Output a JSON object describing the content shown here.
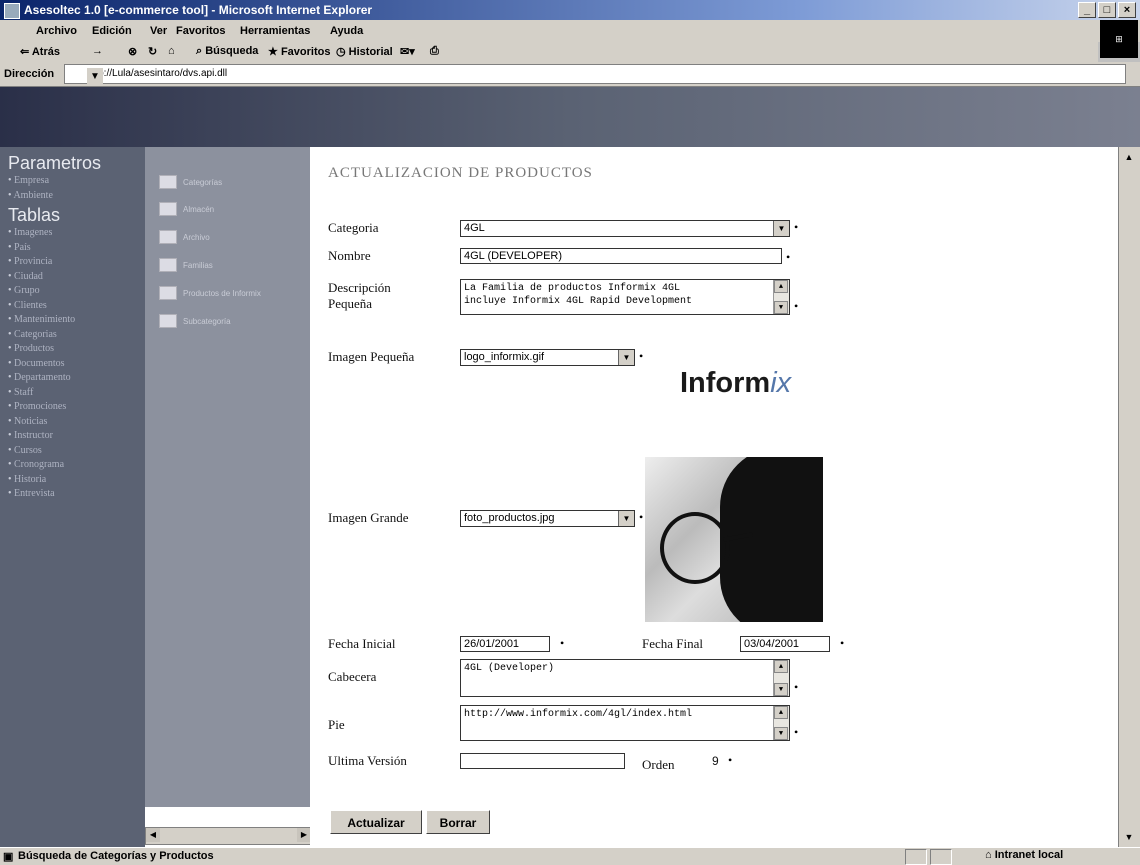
{
  "window": {
    "title": "Asesoltec 1.0 [e-commerce tool] - Microsoft Internet Explorer",
    "min": "_",
    "max": "□",
    "close": "×"
  },
  "menu": [
    "Archivo",
    "Edición",
    "Ver",
    "Favoritos",
    "Herramientas",
    "Ayuda"
  ],
  "toolbar": {
    "back": "⇐ Atrás",
    "search": "Búsqueda",
    "favorites": "Favoritos",
    "history": "Historial"
  },
  "address": {
    "label": "Dirección",
    "url": "http://Lula/asesintaro/dvs.api.dll"
  },
  "nav": {
    "section1": "Parametros",
    "section1_items": [
      "Empresa",
      "Ambiente"
    ],
    "section2": "Tablas",
    "section2_items": [
      "Imagenes",
      "País",
      "Provincia",
      "Ciudad",
      "Grupo",
      "Clientes",
      "Mantenimiento",
      "Categorias",
      "Productos",
      "Documentos",
      "Departamento",
      "Staff",
      "Promociones",
      "Noticias",
      "Instructor",
      "Cursos",
      "Cronograma",
      "Historia",
      "Entrevista"
    ]
  },
  "tree": {
    "nodes": [
      "Categorías",
      "Almacén",
      "Archivo",
      "Familias",
      "Productos de Informix",
      "Subcategoría"
    ]
  },
  "form": {
    "title": "ACTUALIZACION DE PRODUCTOS",
    "categoria_label": "Categoria",
    "categoria_value": "4GL",
    "nombre_label": "Nombre",
    "nombre_value": "4GL (DEVELOPER)",
    "descripcion_label1": "Descripción",
    "descripcion_label2": "Pequeña",
    "descripcion_line1": "La Familia de productos Informix 4GL",
    "descripcion_line2": "incluye Informix 4GL Rapid Development",
    "imagen_pequena_label": "Imagen Pequeña",
    "imagen_pequena_value": "logo_informix.gif",
    "logo_text_main": "Inform",
    "logo_text_accent": "ix",
    "imagen_grande_label": "Imagen Grande",
    "imagen_grande_value": "foto_productos.jpg",
    "fecha_inicial_label": "Fecha Inicial",
    "fecha_inicial_value": "26/01/2001",
    "fecha_final_label": "Fecha Final",
    "fecha_final_value": "03/04/2001",
    "cabecera_label": "Cabecera",
    "cabecera_value": "4GL (Developer)",
    "pie_label": "Pie",
    "pie_value": "http://www.informix.com/4gl/index.html",
    "ultima_version_label": "Ultima Versión",
    "ultima_version_value": "",
    "orden_label": "Orden",
    "orden_value": "9",
    "required_mark": "•",
    "actualizar_button": "Actualizar",
    "borrar_button": "Borrar"
  },
  "status": {
    "text": "Búsqueda de Categorías y Productos",
    "zone": "Intranet local"
  }
}
